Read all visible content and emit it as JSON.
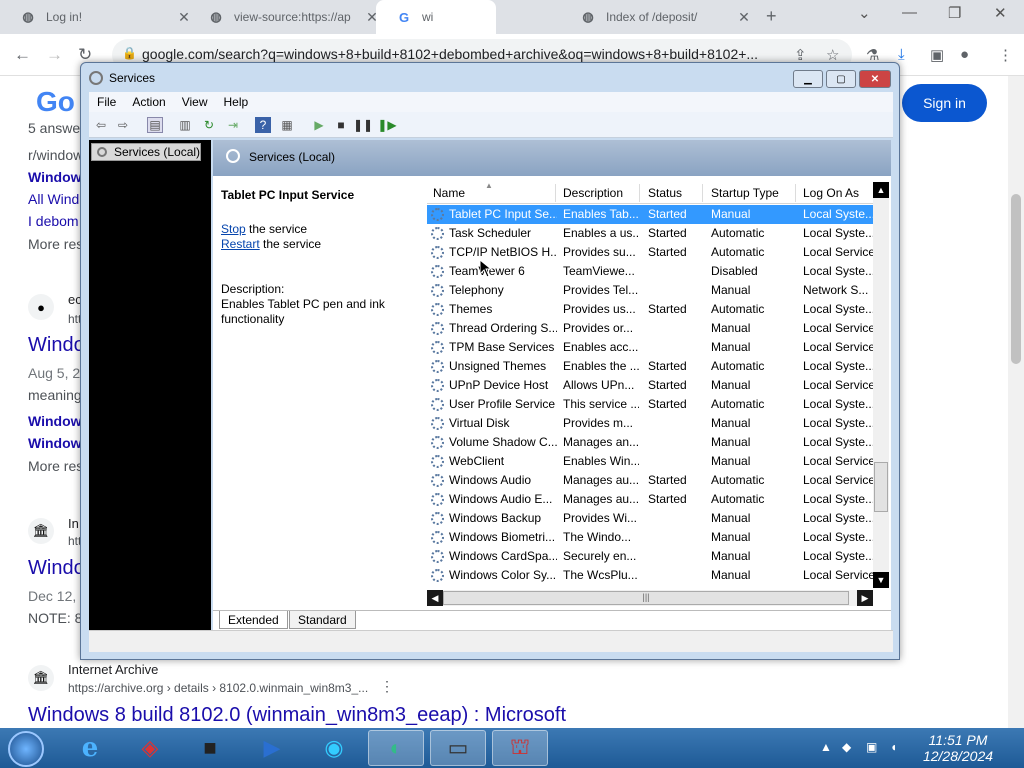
{
  "browser": {
    "tabs": [
      {
        "title": "Log in!",
        "icon": "globe-icon"
      },
      {
        "title": "view-source:https://ap",
        "icon": "globe-icon"
      },
      {
        "title": "wi",
        "icon": "google-icon"
      },
      {
        "title": "Index of /deposit/",
        "icon": "globe-icon"
      }
    ],
    "new_tab_label": "+",
    "address": "google.com/search?q=windows+8+build+8102+debombed+archive&oq=windows+8+build+8102+..."
  },
  "google": {
    "logo": "Go",
    "sign_in": "Sign in",
    "lines": [
      {
        "text": "5 answe"
      },
      {
        "text": "r/window"
      },
      {
        "text": "Window"
      },
      {
        "text": "All Wind"
      },
      {
        "text": "I debom"
      },
      {
        "text": "More res"
      }
    ],
    "result1": {
      "site": "ec",
      "url": "htt",
      "title": "Windo",
      "date": "Aug 5, 2",
      "snippet": "meaning",
      "link1": "Window",
      "link2": "Window",
      "more": "More res"
    },
    "result2": {
      "site": "In",
      "url": "htt",
      "title": "Windo",
      "date": "Dec 12,",
      "snippet": "NOTE: 8"
    },
    "result3": {
      "site": "Internet Archive",
      "url": "https://archive.org › details › 8102.0.winmain_win8m3_...",
      "title": "Windows 8 build 8102.0 (winmain_win8m3_eeap) : Microsoft"
    }
  },
  "services_window": {
    "title": "Services",
    "menu": [
      "File",
      "Action",
      "View",
      "Help"
    ],
    "tree_item": "Services (Local)",
    "pane_title": "Services (Local)",
    "detail": {
      "service_name": "Tablet PC Input Service",
      "stop_link": "Stop",
      "stop_rest": " the service",
      "restart_link": "Restart",
      "restart_rest": " the service",
      "desc_label": "Description:",
      "desc_text": "Enables Tablet PC pen and ink functionality"
    },
    "columns": [
      "Name",
      "Description",
      "Status",
      "Startup Type",
      "Log On As"
    ],
    "rows": [
      [
        "Tablet PC Input Se...",
        "Enables Tab...",
        "Started",
        "Manual",
        "Local Syste..."
      ],
      [
        "Task Scheduler",
        "Enables a us...",
        "Started",
        "Automatic",
        "Local Syste..."
      ],
      [
        "TCP/IP NetBIOS H...",
        "Provides su...",
        "Started",
        "Automatic",
        "Local Service"
      ],
      [
        "TeamViewer 6",
        "TeamViewe...",
        "",
        "Disabled",
        "Local Syste..."
      ],
      [
        "Telephony",
        "Provides Tel...",
        "",
        "Manual",
        "Network S..."
      ],
      [
        "Themes",
        "Provides us...",
        "Started",
        "Automatic",
        "Local Syste..."
      ],
      [
        "Thread Ordering S...",
        "Provides or...",
        "",
        "Manual",
        "Local Service"
      ],
      [
        "TPM Base Services",
        "Enables acc...",
        "",
        "Manual",
        "Local Service"
      ],
      [
        "Unsigned Themes",
        "Enables the ...",
        "Started",
        "Automatic",
        "Local Syste..."
      ],
      [
        "UPnP Device Host",
        "Allows UPn...",
        "Started",
        "Manual",
        "Local Service"
      ],
      [
        "User Profile Service",
        "This service ...",
        "Started",
        "Automatic",
        "Local Syste..."
      ],
      [
        "Virtual Disk",
        "Provides m...",
        "",
        "Manual",
        "Local Syste..."
      ],
      [
        "Volume Shadow C...",
        "Manages an...",
        "",
        "Manual",
        "Local Syste..."
      ],
      [
        "WebClient",
        "Enables Win...",
        "",
        "Manual",
        "Local Service"
      ],
      [
        "Windows Audio",
        "Manages au...",
        "Started",
        "Automatic",
        "Local Service"
      ],
      [
        "Windows Audio E...",
        "Manages au...",
        "Started",
        "Automatic",
        "Local Syste..."
      ],
      [
        "Windows Backup",
        "Provides Wi...",
        "",
        "Manual",
        "Local Syste..."
      ],
      [
        "Windows Biometri...",
        "The Windo...",
        "",
        "Manual",
        "Local Syste..."
      ],
      [
        "Windows CardSpa...",
        "Securely en...",
        "",
        "Manual",
        "Local Syste..."
      ],
      [
        "Windows Color Sy...",
        "The WcsPlu...",
        "",
        "Manual",
        "Local Service"
      ]
    ],
    "selected_row": 0,
    "view_tabs": [
      "Extended",
      "Standard"
    ]
  },
  "taskbar": {
    "time": "11:51 PM",
    "date": "12/28/2024"
  }
}
